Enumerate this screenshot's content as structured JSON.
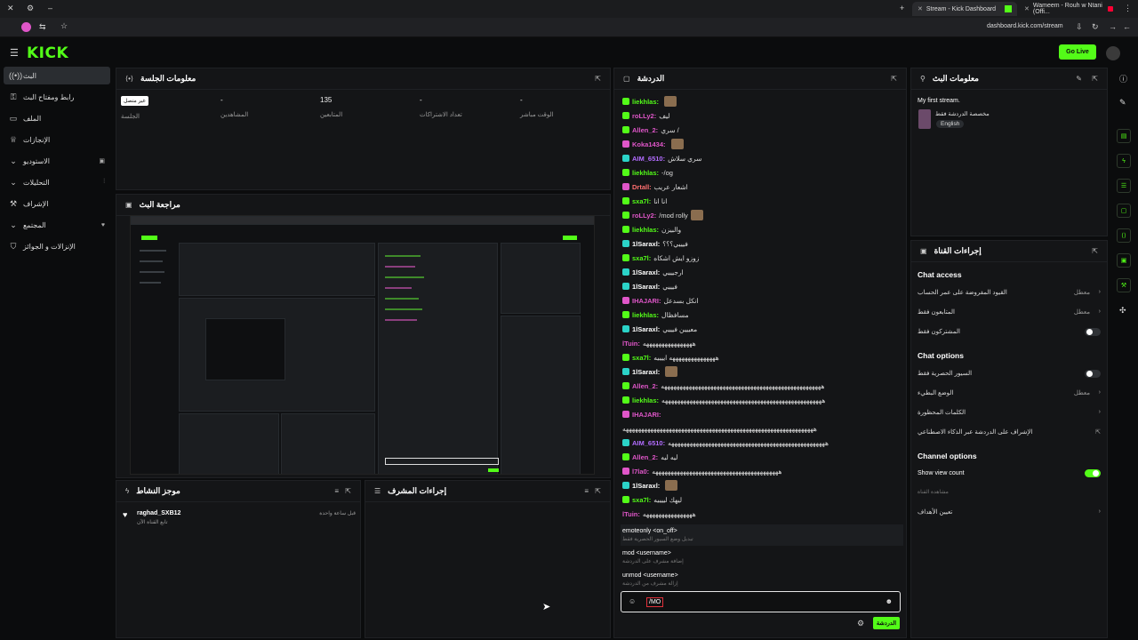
{
  "browser": {
    "tabs": [
      {
        "label": "Stream - Kick Dashboard",
        "active": true
      },
      {
        "label": "Wameem - Rouh w Ntani (Offi..."
      }
    ],
    "url": "dashboard.kick.com/stream"
  },
  "header": {
    "logo": "KICK",
    "go_live_label": "Go Live"
  },
  "sidebar": {
    "items": [
      {
        "label": "البث",
        "icon": "stream-icon",
        "active": true
      },
      {
        "label": "رابط ومفتاح البث",
        "icon": "key-icon"
      },
      {
        "label": "الملف",
        "icon": "folder-icon"
      },
      {
        "label": "الإنجازات",
        "icon": "trophy-icon"
      },
      {
        "label": "الاستوديو",
        "icon": "studio-icon"
      },
      {
        "label": "التحليلات",
        "icon": "analytics-icon"
      },
      {
        "label": "الإشراف",
        "icon": "moderation-icon"
      },
      {
        "label": "المجتمع",
        "icon": "community-icon"
      },
      {
        "label": "الإنزالات و الجوائز",
        "icon": "drops-icon"
      }
    ]
  },
  "session": {
    "title": "معلومات الجلسة",
    "stats": [
      {
        "value": "غير متصل",
        "label": "الجلسة"
      },
      {
        "value": "-",
        "label": "المشاهدين"
      },
      {
        "value": "135",
        "label": "المتابعين"
      },
      {
        "value": "-",
        "label": "تعداد الاشتراكات"
      },
      {
        "value": "-",
        "label": "الوقت مباشر"
      }
    ]
  },
  "preview": {
    "title": "مراجعة البث"
  },
  "activity": {
    "title": "موجز النشاط",
    "entries": [
      {
        "user": "raghad_SXB12",
        "desc": "تابع القناة الآن",
        "time": "قبل ساعة واحدة"
      }
    ]
  },
  "modactions": {
    "title": "إجراءات المشرف"
  },
  "chat": {
    "title": "الدردشة",
    "messages": [
      {
        "user": "liekhlas:",
        "text": "",
        "color": "#53fc18",
        "badge": "g",
        "emote": true
      },
      {
        "user": "roLLy2:",
        "text": "ليف",
        "color": "#e056c9",
        "badge": "g"
      },
      {
        "user": "Allen_2:",
        "text": "سري /",
        "color": "#e056c9",
        "badge": "g"
      },
      {
        "user": "Koka1434:",
        "text": "",
        "color": "#e056c9",
        "badge": "p",
        "emote": true
      },
      {
        "user": "AIM_6510:",
        "text": "سري سلاش",
        "color": "#b26cff",
        "badge": "t"
      },
      {
        "user": "liekhlas:",
        "text": "-/og",
        "color": "#53fc18",
        "badge": "g"
      },
      {
        "user": "Drtall:",
        "text": "اشعار عريب",
        "color": "#ff6f6f",
        "badge": "p"
      },
      {
        "user": "sxa7l:",
        "text": "انا انا",
        "color": "#53fc18",
        "badge": "g"
      },
      {
        "user": "roLLy2:",
        "text": "/mod rolly",
        "color": "#e056c9",
        "badge": "g",
        "emote": true
      },
      {
        "user": "liekhlas:",
        "text": "والبيزن",
        "color": "#53fc18",
        "badge": "g"
      },
      {
        "user": "1lSaraxl:",
        "text": "فيييي؟؟؟",
        "color": "#ffffff",
        "badge": "t"
      },
      {
        "user": "sxa7l:",
        "text": "زوزو ايش اشكاه",
        "color": "#53fc18",
        "badge": "g"
      },
      {
        "user": "1lSaraxl:",
        "text": "ارجيييي",
        "color": "#ffffff",
        "badge": "t"
      },
      {
        "user": "1lSaraxl:",
        "text": "فيييي",
        "color": "#ffffff",
        "badge": "t"
      },
      {
        "user": "IHAJARI:",
        "text": "انكل بسدعل",
        "color": "#e056c9",
        "badge": "p"
      },
      {
        "user": "liekhlas:",
        "text": "مسافظال",
        "color": "#53fc18",
        "badge": "g"
      },
      {
        "user": "1lSaraxl:",
        "text": "معييين فيييي",
        "color": "#ffffff",
        "badge": "t"
      },
      {
        "user": "lTuin:",
        "text": "ههههههههههههههههه",
        "color": "#e056c9",
        "badge": ""
      },
      {
        "user": "sxa7l:",
        "text": "هههههههههههههههه اييييه",
        "color": "#53fc18",
        "badge": "g"
      },
      {
        "user": "1lSaraxl:",
        "text": "",
        "color": "#ffffff",
        "badge": "t",
        "emote": true
      },
      {
        "user": "Allen_2:",
        "text": "ههههههههههههههههههههههههههههههههههههههههههههههههههههه",
        "color": "#e056c9",
        "badge": "g"
      },
      {
        "user": "liekhlas:",
        "text": "ههههههههههههههههههههههههههههههههههههههههههههههههههههه",
        "color": "#53fc18",
        "badge": "g"
      },
      {
        "user": "IHAJARI:",
        "text": "",
        "color": "#e056c9",
        "badge": "p"
      },
      {
        "user": "",
        "text": "ههههههههههههههههههههههههههههههههههههههههههههههههههههههههههههههه",
        "color": "#ddd",
        "badge": ""
      },
      {
        "user": "AIM_6510:",
        "text": "هههههههههههههههههههههههههههههههههههههههههههههههههههه",
        "color": "#b26cff",
        "badge": "t"
      },
      {
        "user": "Allen_2:",
        "text": "ليه ليه",
        "color": "#e056c9",
        "badge": "g"
      },
      {
        "user": "l7la0:",
        "text": "هههههههههههههههههههههههههههههههههههههههههه",
        "color": "#e056c9",
        "badge": "p"
      },
      {
        "user": "1lSaraxl:",
        "text": "",
        "color": "#ffffff",
        "badge": "t",
        "emote": true
      },
      {
        "user": "sxa7l:",
        "text": "ليهك لييييه",
        "color": "#53fc18",
        "badge": "g"
      },
      {
        "user": "lTuin:",
        "text": "ههههههههههههههههه",
        "color": "#e056c9",
        "badge": ""
      }
    ],
    "commands": [
      {
        "cmd": "emoteonly <on_off>",
        "desc": "تبديل وضع السيور الحصرية فقط"
      },
      {
        "cmd": "mod <username>",
        "desc": "إضافة مشرف على الدردشة"
      },
      {
        "cmd": "unmod <username>",
        "desc": "إزالة مشرف من الدردشة"
      }
    ],
    "input_value": "/MO",
    "send_label": "الدردشة"
  },
  "streaminfo": {
    "title": "معلومات البث",
    "stream_title": "My first stream.",
    "category": "مخصصة الدردشة فقط",
    "language": "English"
  },
  "channelactions": {
    "title": "إجراءات القناة",
    "chat_access_title": "Chat access",
    "chat_access": [
      {
        "label": "القيود المفروضة على عمر الحساب",
        "value": "معطل",
        "chevron": true
      },
      {
        "label": "المتابعون فقط",
        "value": "معطل",
        "chevron": true
      },
      {
        "label": "المشتركون فقط",
        "toggle": false
      }
    ],
    "chat_options_title": "Chat options",
    "chat_options": [
      {
        "label": "السيور الحصرية فقط",
        "toggle": false
      },
      {
        "label": "الوضع البطيء",
        "value": "معطل",
        "chevron": true
      },
      {
        "label": "الكلمات المحظورة",
        "chevron": true
      },
      {
        "label": "الإشراف على الدردشة عبر الذكاء الاصطناعي",
        "external": true
      }
    ],
    "channel_options_title": "Channel options",
    "show_view_count": "Show view count",
    "show_view_count_sub": "مشاهدة القناة",
    "targets_label": "تعيين الأهداف"
  }
}
